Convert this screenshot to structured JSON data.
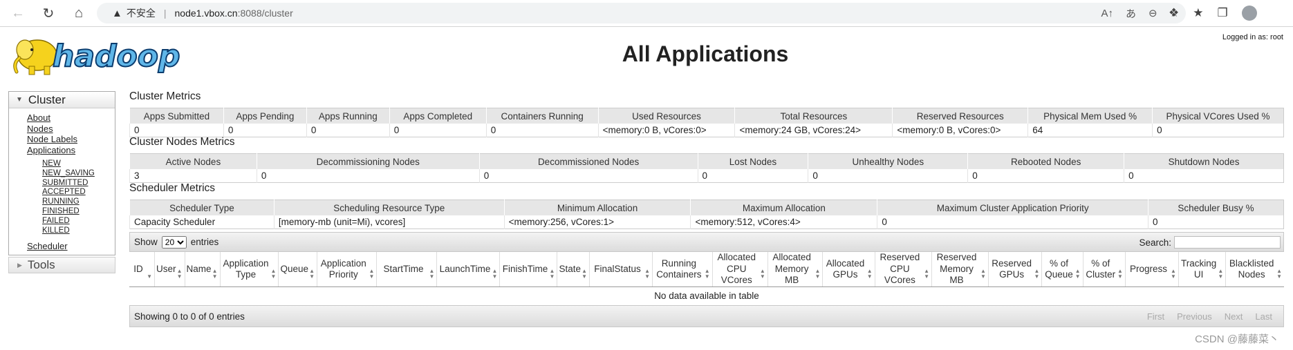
{
  "browser": {
    "insecure_label": "不安全",
    "url_host": "node1.vbox.cn",
    "url_path": ":8088/cluster"
  },
  "header": {
    "logged_in": "Logged in as: root",
    "title": "All Applications",
    "logo_text": "hadoop"
  },
  "sidebar": {
    "cluster_label": "Cluster",
    "links": [
      "About",
      "Nodes",
      "Node Labels",
      "Applications"
    ],
    "app_states": [
      "NEW",
      "NEW_SAVING",
      "SUBMITTED",
      "ACCEPTED",
      "RUNNING",
      "FINISHED",
      "FAILED",
      "KILLED"
    ],
    "scheduler_label": "Scheduler",
    "tools_label": "Tools"
  },
  "cluster_metrics": {
    "title": "Cluster Metrics",
    "headers": [
      "Apps Submitted",
      "Apps Pending",
      "Apps Running",
      "Apps Completed",
      "Containers Running",
      "Used Resources",
      "Total Resources",
      "Reserved Resources",
      "Physical Mem Used %",
      "Physical VCores Used %"
    ],
    "values": [
      "0",
      "0",
      "0",
      "0",
      "0",
      "<memory:0 B, vCores:0>",
      "<memory:24 GB, vCores:24>",
      "<memory:0 B, vCores:0>",
      "64",
      "0"
    ]
  },
  "nodes_metrics": {
    "title": "Cluster Nodes Metrics",
    "headers": [
      "Active Nodes",
      "Decommissioning Nodes",
      "Decommissioned Nodes",
      "Lost Nodes",
      "Unhealthy Nodes",
      "Rebooted Nodes",
      "Shutdown Nodes"
    ],
    "values": [
      "3",
      "0",
      "0",
      "0",
      "0",
      "0",
      "0"
    ]
  },
  "scheduler_metrics": {
    "title": "Scheduler Metrics",
    "headers": [
      "Scheduler Type",
      "Scheduling Resource Type",
      "Minimum Allocation",
      "Maximum Allocation",
      "Maximum Cluster Application Priority",
      "Scheduler Busy %"
    ],
    "values": [
      "Capacity Scheduler",
      "[memory-mb (unit=Mi), vcores]",
      "<memory:256, vCores:1>",
      "<memory:512, vCores:4>",
      "0",
      "0"
    ]
  },
  "apps_table": {
    "show_label": "Show",
    "entries_label": "entries",
    "page_size": "20",
    "search_label": "Search:",
    "columns": [
      "ID",
      "User",
      "Name",
      "Application Type",
      "Queue",
      "Application Priority",
      "StartTime",
      "LaunchTime",
      "FinishTime",
      "State",
      "FinalStatus",
      "Running Containers",
      "Allocated CPU VCores",
      "Allocated Memory MB",
      "Allocated GPUs",
      "Reserved CPU VCores",
      "Reserved Memory MB",
      "Reserved GPUs",
      "% of Queue",
      "% of Cluster",
      "Progress",
      "Tracking UI",
      "Blacklisted Nodes"
    ],
    "empty_message": "No data available in table",
    "info": "Showing 0 to 0 of 0 entries",
    "pager": [
      "First",
      "Previous",
      "Next",
      "Last"
    ]
  },
  "watermark": "CSDN @藤藤菜丶"
}
